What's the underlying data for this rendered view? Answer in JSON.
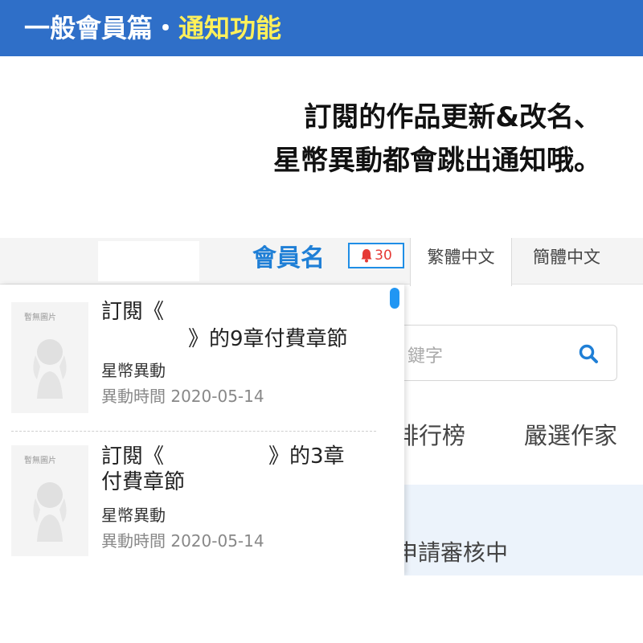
{
  "header": {
    "part1": "一般會員篇",
    "separator": "・",
    "part2": "通知功能",
    "colors": {
      "background": "#2f6fc8",
      "text": "#ffffff",
      "highlight": "#fff05a"
    }
  },
  "caption": {
    "line1": "訂閱的作品更新&改名、",
    "line2": "星幣異動都會跳出通知哦。"
  },
  "topbar": {
    "member_name": "會員名",
    "notification_count": "30",
    "icons": {
      "bell": "bell-icon",
      "search": "search-icon"
    },
    "languages": [
      {
        "label": "繁體中文",
        "active": true
      },
      {
        "label": "簡體中文",
        "active": false
      }
    ]
  },
  "search": {
    "placeholder_partial": "鍵字"
  },
  "nav": {
    "ranking_partial": "排行榜",
    "picks": "嚴選作家"
  },
  "status": {
    "apply_partial": "申請審核中"
  },
  "notifications": [
    {
      "thumb_label": "暫無圖片",
      "title_line1": "訂閱《",
      "title_line2": "》的9章付費章節",
      "type": "星幣異動",
      "time": "異動時間 2020-05-14"
    },
    {
      "thumb_label": "暫無圖片",
      "title_line1": "訂閱《",
      "title_line1_end": "》的3章",
      "title_line2": "付費章節",
      "type": "星幣異動",
      "time": "異動時間 2020-05-14"
    }
  ],
  "accent_colors": {
    "link_blue": "#1f7fd6",
    "badge_red": "#e53935",
    "scroll_blue": "#2196f3"
  }
}
